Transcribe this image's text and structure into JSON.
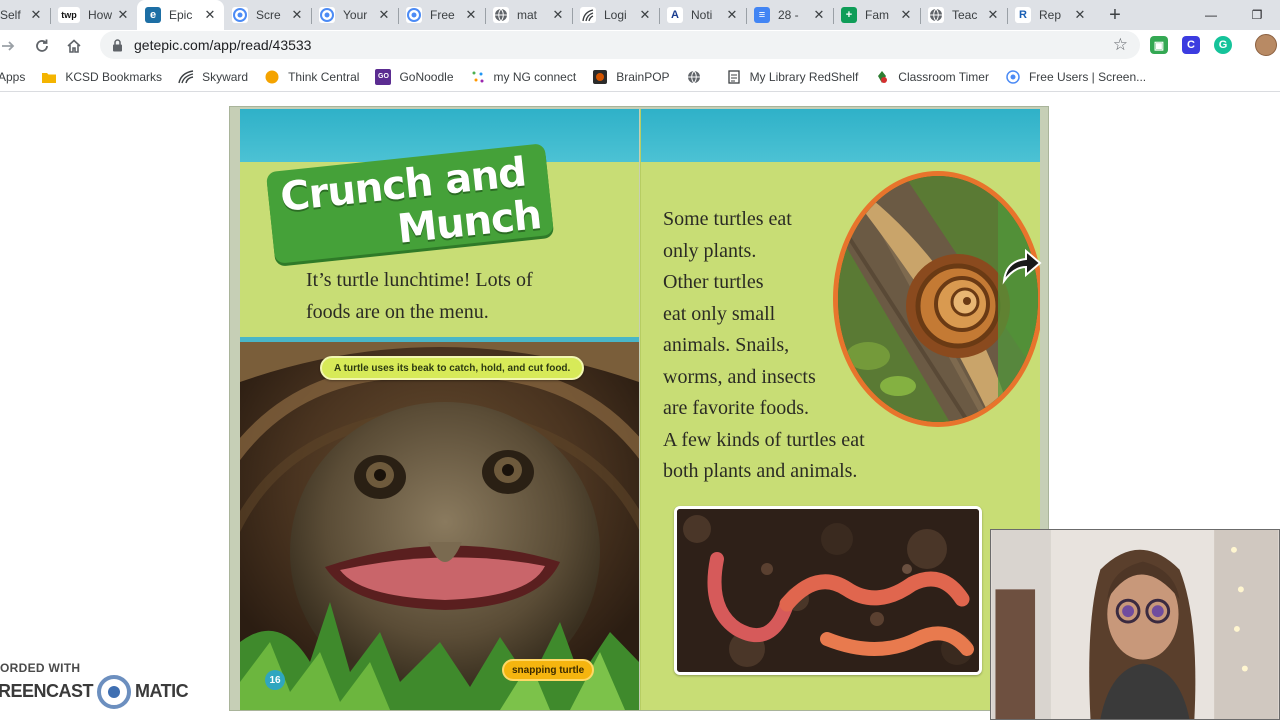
{
  "browser": {
    "tabs": [
      {
        "title": "Self",
        "favicon": "page-icon",
        "active": false
      },
      {
        "title": "How",
        "favicon": "twp-icon",
        "favicon_text": "twp",
        "active": false
      },
      {
        "title": "Epic",
        "favicon": "epic-icon",
        "favicon_text": "e",
        "active": true
      },
      {
        "title": "Scre",
        "favicon": "screencast-icon",
        "active": false
      },
      {
        "title": "Your",
        "favicon": "screencast-icon",
        "active": false
      },
      {
        "title": "Free",
        "favicon": "screencast-icon",
        "active": false
      },
      {
        "title": "mat",
        "favicon": "globe-icon",
        "active": false
      },
      {
        "title": "Logi",
        "favicon": "skyward-icon",
        "active": false
      },
      {
        "title": "Noti",
        "favicon": "letter-a-icon",
        "favicon_text": "A",
        "active": false
      },
      {
        "title": "28 -",
        "favicon": "docs-icon",
        "active": false
      },
      {
        "title": "Fam",
        "favicon": "sheets-plus-icon",
        "active": false
      },
      {
        "title": "Teac",
        "favicon": "globe-icon",
        "active": false
      },
      {
        "title": "Rep",
        "favicon": "letter-r-icon",
        "favicon_text": "R",
        "active": false
      }
    ],
    "close_glyph": "✕",
    "new_tab_glyph": "+",
    "window_buttons": {
      "minimize": "—",
      "restore": "❐"
    },
    "url": "getepic.com/app/read/43533",
    "extensions": [
      {
        "name": "green-extension-icon",
        "color": "#34a853",
        "glyph": "▣"
      },
      {
        "name": "c-extension-icon",
        "color": "#3c3ce0",
        "glyph": "C"
      },
      {
        "name": "grammarly-icon",
        "color": "#15c39a",
        "glyph": "G"
      }
    ]
  },
  "bookmarks": [
    {
      "label": "Apps",
      "icon": "apps-icon"
    },
    {
      "label": "KCSD Bookmarks",
      "icon": "folder-icon",
      "color": "#f4b400"
    },
    {
      "label": "Skyward",
      "icon": "skyward-icon"
    },
    {
      "label": "Think Central",
      "icon": "circle-icon",
      "color": "#f4a300"
    },
    {
      "label": "GoNoodle",
      "icon": "gonoodle-icon",
      "color": "#5b2c91",
      "glyph": "GO"
    },
    {
      "label": "my NG connect",
      "icon": "dots-icon"
    },
    {
      "label": "BrainPOP",
      "icon": "brainpop-icon",
      "color": "#d35400"
    },
    {
      "label": "",
      "icon": "globe-icon"
    },
    {
      "label": "My Library RedShelf",
      "icon": "page-icon"
    },
    {
      "label": "Classroom Timer",
      "icon": "timer-icon",
      "color": "#2e7d32"
    },
    {
      "label": "Free Users | Screen...",
      "icon": "screencast-icon"
    }
  ],
  "book": {
    "title_line1": "Crunch and",
    "title_line2": "Munch",
    "left_text": [
      "It’s turtle lunchtime! Lots of",
      "foods are on the menu."
    ],
    "caption": "A turtle uses its beak to catch, hold, and cut food.",
    "photo_label": "snapping turtle",
    "page_number": "16",
    "right_text": [
      "Some turtles eat",
      "only plants.",
      "Other turtles",
      "eat only small",
      "animals. Snails,",
      "worms, and insects",
      "are favorite foods.",
      "A few kinds of turtles eat",
      "both plants and animals."
    ]
  },
  "watermark": {
    "top": "ORDED WITH",
    "left": "REENCAST",
    "right": "MATIC"
  },
  "colors": {
    "page_green": "#c8dd75",
    "teal": "#2fb1c8",
    "headline_green": "#45a139",
    "snail_ring": "#e8742c"
  }
}
